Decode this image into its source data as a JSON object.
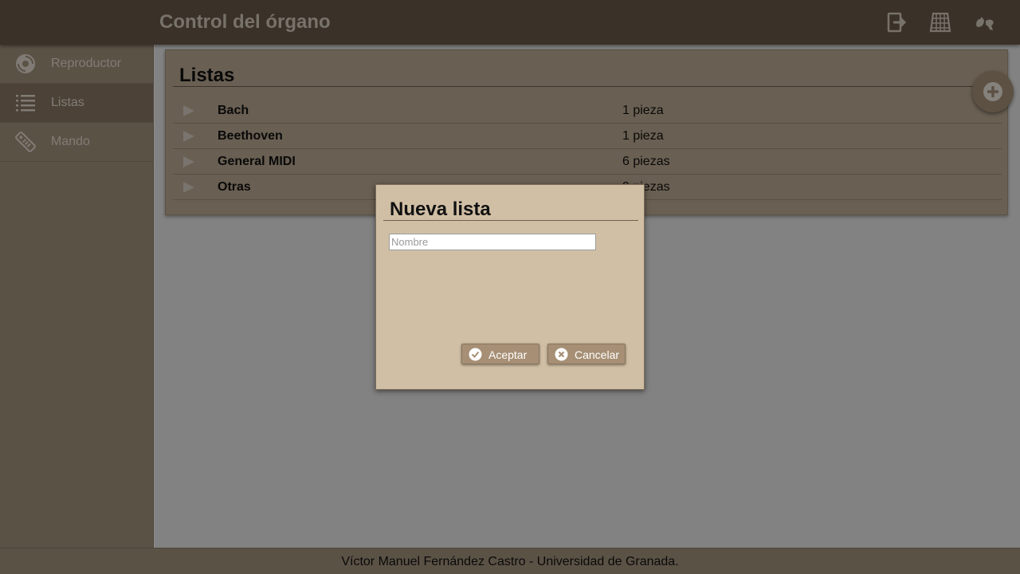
{
  "header": {
    "title": "Control del órgano",
    "icons": [
      "exit-icon",
      "keyboard-icon",
      "sign-language-icon"
    ]
  },
  "sidebar": {
    "items": [
      {
        "label": "Reproductor",
        "icon": "disc-icon",
        "active": false
      },
      {
        "label": "Listas",
        "icon": "list-icon",
        "active": true
      },
      {
        "label": "Mando",
        "icon": "remote-icon",
        "active": false
      }
    ]
  },
  "main": {
    "title": "Listas",
    "add_icon": "plus-icon",
    "lists": [
      {
        "name": "Bach",
        "count": "1 pieza"
      },
      {
        "name": "Beethoven",
        "count": "1 pieza"
      },
      {
        "name": "General MIDI",
        "count": "6 piezas"
      },
      {
        "name": "Otras",
        "count": "9 piezas"
      }
    ]
  },
  "dialog": {
    "title": "Nueva lista",
    "name_placeholder": "Nombre",
    "name_value": "",
    "accept_label": "Aceptar",
    "cancel_label": "Cancelar"
  },
  "footer": {
    "text": "Víctor Manuel Fernández Castro - Universidad de Granada."
  },
  "colors": {
    "header_bg": "#6b5a4a",
    "sidebar_bg": "#a69580",
    "panel_bg": "#bfad95",
    "dialog_bg": "#d1bfa5",
    "button_bg": "#a68f74"
  }
}
